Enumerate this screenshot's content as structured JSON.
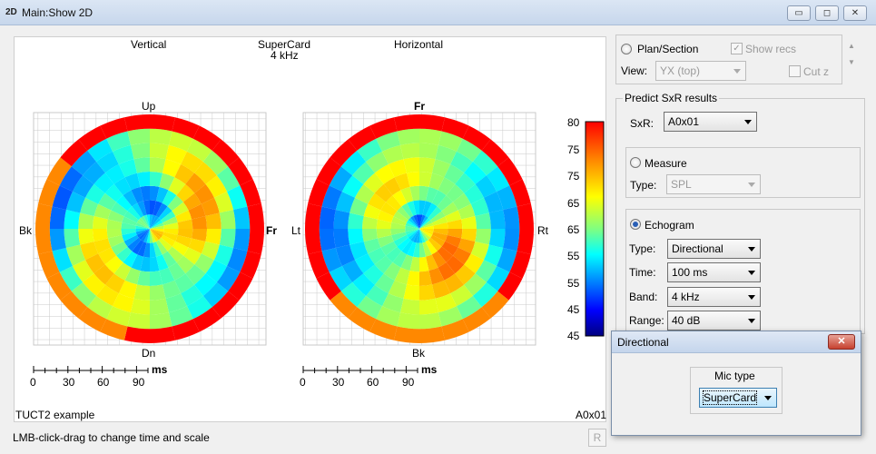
{
  "window": {
    "icon": "2D",
    "title": "Main:Show 2D",
    "minimize": "▭",
    "maximize": "◻",
    "close": "✕"
  },
  "plot": {
    "left_title": "Vertical",
    "center_title": "SuperCard",
    "center_sub": "4 kHz",
    "right_title": "Horizontal",
    "left_labels": {
      "top": "Up",
      "bottom": "Dn",
      "left": "Bk",
      "right": "Fr"
    },
    "right_labels": {
      "top": "Fr",
      "bottom": "Bk",
      "left": "Lt",
      "right": "Rt"
    },
    "time_unit": "ms",
    "time_ticks": [
      "0",
      "30",
      "60",
      "90"
    ],
    "color_scale": [
      "80",
      "75",
      "70",
      "65",
      "60",
      "55",
      "50",
      "45",
      "40"
    ],
    "footer_left": "TUCT2 example",
    "footer_right": "A0x01"
  },
  "sidebar": {
    "plan_section": "Plan/Section",
    "show_recs": "Show recs",
    "view_label": "View:",
    "view_value": "YX (top)",
    "cut_z": "Cut z",
    "predict_title": "Predict SxR results",
    "sxr_label": "SxR:",
    "sxr_value": "A0x01",
    "measure": "Measure",
    "type_label": "Type:",
    "measure_type": "SPL",
    "echogram": "Echogram",
    "echo_type_label": "Type:",
    "echo_type": "Directional",
    "time_label": "Time:",
    "time_value": "100 ms",
    "band_label": "Band:",
    "band_value": "4 kHz",
    "range_label": "Range:",
    "range_value": "40 dB"
  },
  "popup": {
    "title": "Directional",
    "close": "✕",
    "mic_type_label": "Mic type",
    "mic_type_value": "SuperCard"
  },
  "status": {
    "hint": "LMB-click-drag to change time and scale",
    "r_button": "R"
  }
}
